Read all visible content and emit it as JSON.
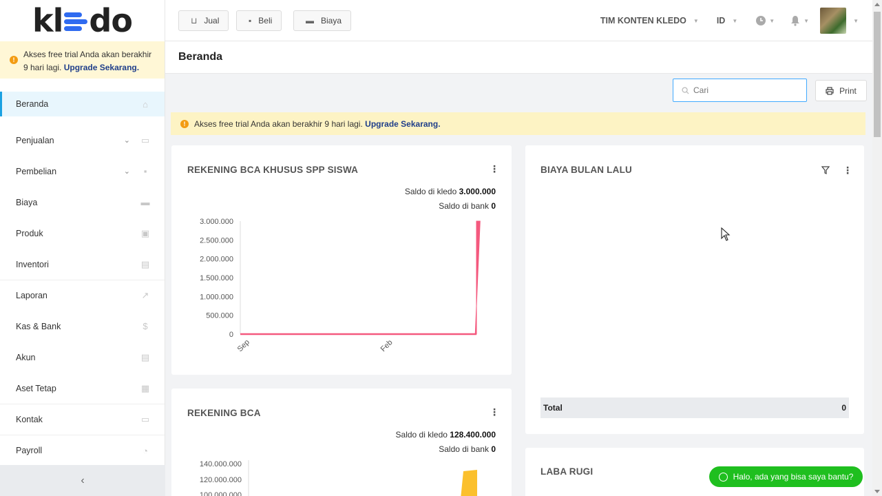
{
  "brand": {
    "logo_left": "kl",
    "logo_right": "do",
    "accent": "#2f6bf0"
  },
  "sidebar": {
    "trial_text": "Akses free trial Anda akan berakhir 9 hari lagi.",
    "trial_link": "Upgrade Sekarang.",
    "items": [
      {
        "label": "Beranda",
        "icon": "home-icon",
        "glyph": "⌂"
      },
      {
        "label": "Penjualan",
        "icon": "basket-icon",
        "glyph": "▭"
      },
      {
        "label": "Pembelian",
        "icon": "bag-icon",
        "glyph": "▪"
      },
      {
        "label": "Biaya",
        "icon": "card-icon",
        "glyph": "▬"
      },
      {
        "label": "Produk",
        "icon": "box-icon",
        "glyph": "▣"
      },
      {
        "label": "Inventori",
        "icon": "warehouse-icon",
        "glyph": "▤"
      },
      {
        "label": "Laporan",
        "icon": "chart-icon",
        "glyph": "↗"
      },
      {
        "label": "Kas & Bank",
        "icon": "dollar-icon",
        "glyph": "$"
      },
      {
        "label": "Akun",
        "icon": "list-icon",
        "glyph": "▤"
      },
      {
        "label": "Aset Tetap",
        "icon": "building-icon",
        "glyph": "▦"
      },
      {
        "label": "Kontak",
        "icon": "contact-icon",
        "glyph": "▭"
      },
      {
        "label": "Payroll",
        "icon": "check-circle-icon",
        "glyph": "◔"
      }
    ],
    "collapse_glyph": "‹"
  },
  "topbar": {
    "buttons": [
      {
        "label": "Jual",
        "icon": "basket-icon",
        "glyph": "⊔"
      },
      {
        "label": "Beli",
        "icon": "bag-icon",
        "glyph": "▪"
      },
      {
        "label": "Biaya",
        "icon": "card-icon",
        "glyph": "▬"
      }
    ],
    "company": "TIM KONTEN KLEDO",
    "language": "ID"
  },
  "page": {
    "title": "Beranda",
    "search_placeholder": "Cari",
    "print_label": "Print",
    "banner_text": "Akses free trial Anda akan berakhir 9 hari lagi.",
    "banner_link": "Upgrade Sekarang."
  },
  "cards": {
    "bca_spp": {
      "title": "REKENING BCA KHUSUS SPP SISWA",
      "saldo_kledo_label": "Saldo di kledo",
      "saldo_kledo_value": "3.000.000",
      "saldo_bank_label": "Saldo di bank",
      "saldo_bank_value": "0"
    },
    "biaya": {
      "title": "BIAYA BULAN LALU",
      "total_label": "Total",
      "total_value": "0"
    },
    "bca": {
      "title": "REKENING BCA",
      "saldo_kledo_label": "Saldo di kledo",
      "saldo_kledo_value": "128.400.000",
      "saldo_bank_label": "Saldo di bank",
      "saldo_bank_value": "0"
    },
    "laba_rugi": {
      "title": "LABA RUGI"
    }
  },
  "chat": {
    "label": "Halo, ada yang bisa saya bantu?"
  },
  "chart_data": [
    {
      "type": "area",
      "color": "#f4597e",
      "ylim": [
        0,
        3000000
      ],
      "yticks": [
        "0",
        "500.000",
        "1.000.000",
        "1.500.000",
        "2.000.000",
        "2.500.000",
        "3.000.000"
      ],
      "xticks": [
        "Sep",
        "Feb"
      ],
      "x": [
        0,
        1,
        2,
        3,
        4,
        5,
        6,
        7,
        8,
        9,
        10,
        11,
        12,
        13,
        14,
        15
      ],
      "values": [
        0,
        0,
        0,
        0,
        0,
        0,
        0,
        0,
        0,
        0,
        0,
        0,
        0,
        0,
        0,
        3000000
      ]
    },
    {
      "type": "area",
      "color": "#fbc02d",
      "ylim": [
        0,
        140000000
      ],
      "yticks": [
        "100.000.000",
        "120.000.000",
        "140.000.000"
      ],
      "values_note_visible": "partial"
    }
  ]
}
